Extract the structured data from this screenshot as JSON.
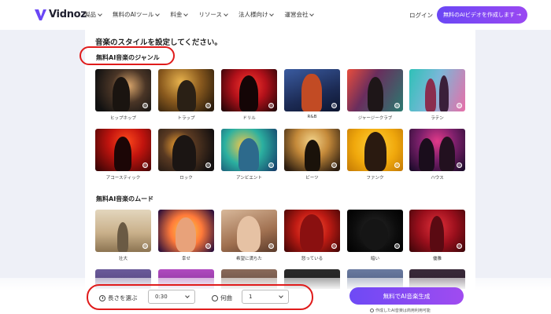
{
  "nav": {
    "logo": "Vidnoz",
    "items": [
      "製品",
      "無料のAIツール",
      "料金",
      "リソース",
      "法人様向け",
      "運営会社"
    ],
    "login": "ログイン",
    "cta": "無料のAIビデオを作成します →"
  },
  "page": {
    "heading": "音楽のスタイルを設定してください。",
    "genre_title": "無料AI音楽のジャンル",
    "mood_title": "無料AI音楽のムード"
  },
  "genres": [
    "ヒップホップ",
    "トラップ",
    "ドリル",
    "R&B",
    "ジャージークラブ",
    "ラテン",
    "アコースティック",
    "ロック",
    "アンビエント",
    "ビーツ",
    "ファンク",
    "ハウス"
  ],
  "moods": [
    "壮大",
    "幸せ",
    "希望に満ちた",
    "怒っている",
    "暗い",
    "優雅"
  ],
  "controls": {
    "length_label": "長さを選ぶ",
    "length_value": "0:30",
    "count_label": "何曲",
    "count_value": "1",
    "generate": "無料でAI音楽生成",
    "note": "作成したAI音楽は商用利用可能"
  },
  "colors": {
    "accent": "#7b4cf4",
    "highlight": "#e01b1b"
  }
}
